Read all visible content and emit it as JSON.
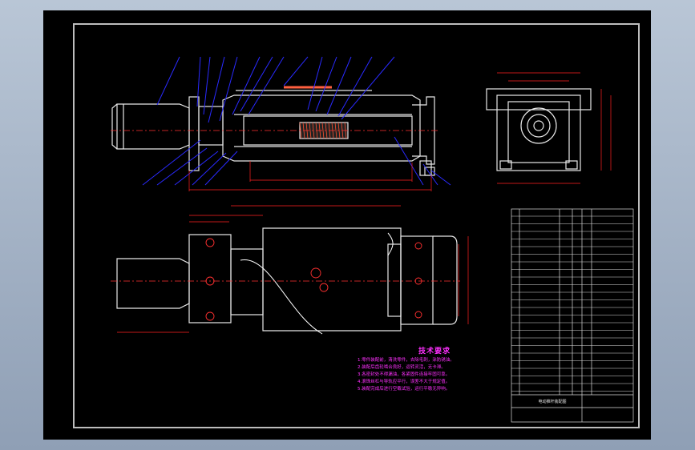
{
  "technical_requirements": {
    "title": "技术要求",
    "lines": [
      "1.零件装配前，清洗零件，去除毛刺，涂防锈油。",
      "2.装配后齿轮啮合良好，运转灵活，无卡滞。",
      "3.各密封处不得漏油，各紧固件连接牢固可靠。",
      "4.滚珠丝杠与导轨应平行，误差不大于规定值。",
      "5.装配完成后进行空载试验，运行平稳无异响。"
    ]
  },
  "title_block": {
    "title": "电动推杆装配图"
  },
  "colors": {
    "sheet_background": "#000000",
    "outline": "#e8e8e8",
    "leader": "#2a2aff",
    "dimension": "#ff2020",
    "centerline": "#ff3030",
    "text_magenta": "#ff30ff",
    "section_line": "#ffffff"
  }
}
